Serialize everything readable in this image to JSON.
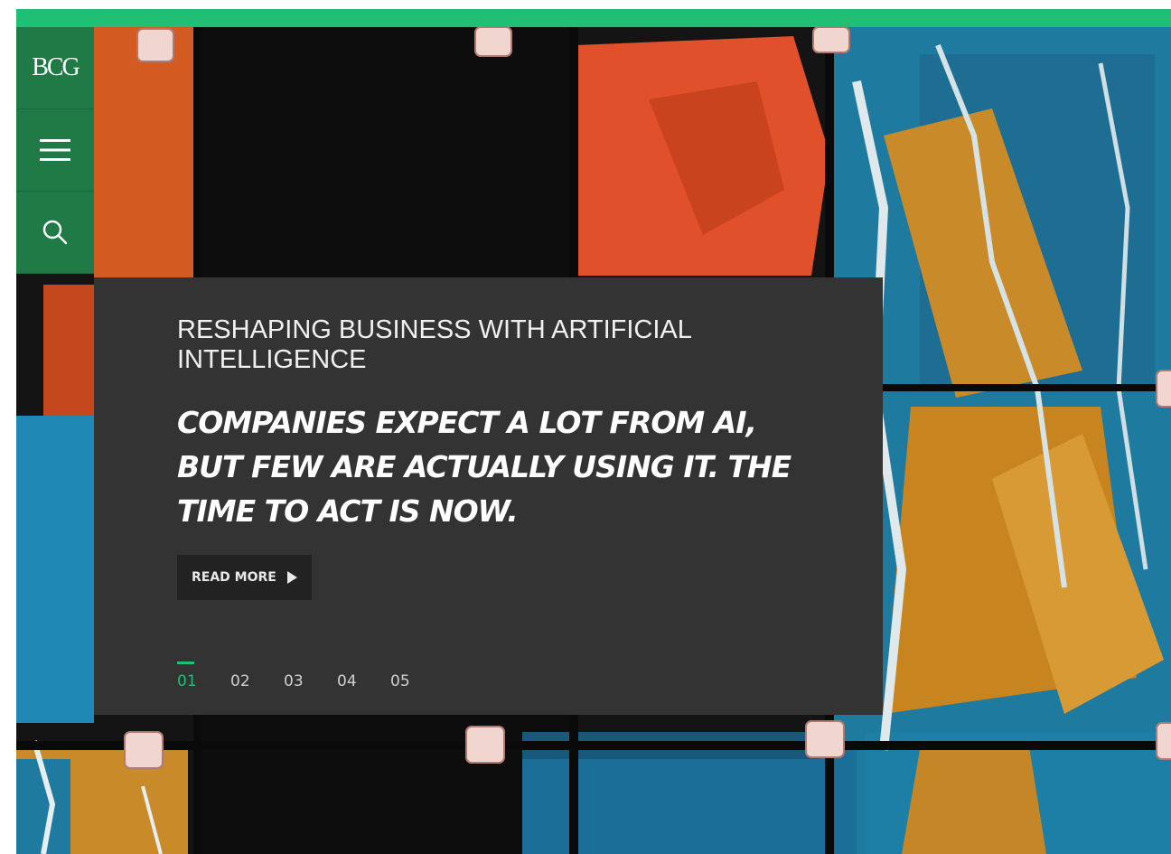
{
  "colors": {
    "brand_green": "#21bf73",
    "nav_green": "#1f7a45",
    "card_bg": "#333333",
    "button_bg": "#222222"
  },
  "nav": {
    "logo": "BCG",
    "menu_icon": "hamburger-menu-icon",
    "search_icon": "search-icon"
  },
  "hero": {
    "kicker": "RESHAPING BUSINESS WITH ARTIFICIAL INTELLIGENCE",
    "headline": "COMPANIES EXPECT A LOT FROM AI, BUT FEW ARE ACTUALLY USING IT. THE TIME TO ACT IS NOW.",
    "read_more": "READ MORE",
    "read_more_icon": "play-arrow-icon",
    "pages": [
      "01",
      "02",
      "03",
      "04",
      "05"
    ],
    "active_page": "01"
  }
}
